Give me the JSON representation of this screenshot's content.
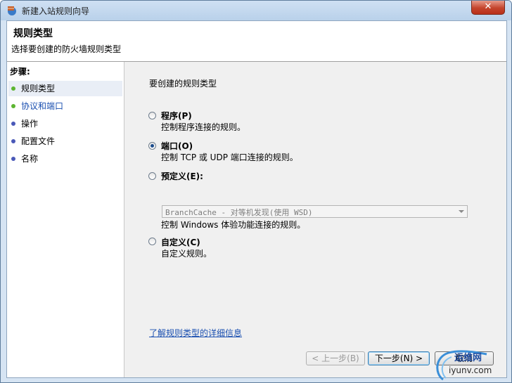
{
  "window": {
    "title": "新建入站规则向导",
    "close_label": "✕"
  },
  "header": {
    "title": "规则类型",
    "subtitle": "选择要创建的防火墙规则类型"
  },
  "steps": {
    "label": "步骤:",
    "items": [
      {
        "label": "规则类型",
        "color": "#5cb531",
        "active": true
      },
      {
        "label": "协议和端口",
        "color": "#5cb531",
        "active": false
      },
      {
        "label": "操作",
        "color": "#4a59b8",
        "active": false
      },
      {
        "label": "配置文件",
        "color": "#4a59b8",
        "active": false
      },
      {
        "label": "名称",
        "color": "#4a59b8",
        "active": false
      }
    ]
  },
  "main": {
    "prompt": "要创建的规则类型",
    "options": [
      {
        "label": "程序(P)",
        "desc": "控制程序连接的规则。",
        "checked": false
      },
      {
        "label": "端口(O)",
        "desc": "控制 TCP 或 UDP 端口连接的规则。",
        "checked": true
      },
      {
        "label": "预定义(E):",
        "desc": "控制 Windows 体验功能连接的规则。",
        "checked": false,
        "select_value": "BranchCache - 对等机发现(使用 WSD)"
      },
      {
        "label": "自定义(C)",
        "desc": "自定义规则。",
        "checked": false
      }
    ],
    "link": "了解规则类型的详细信息"
  },
  "buttons": {
    "back": "< 上一步(B)",
    "next": "下一步(N) >",
    "cancel": "取消"
  },
  "watermark": {
    "line1": "运维网",
    "line2": "iyunv.com"
  },
  "colors": {
    "accent": "#1a4fb0",
    "close": "#c4442c"
  }
}
